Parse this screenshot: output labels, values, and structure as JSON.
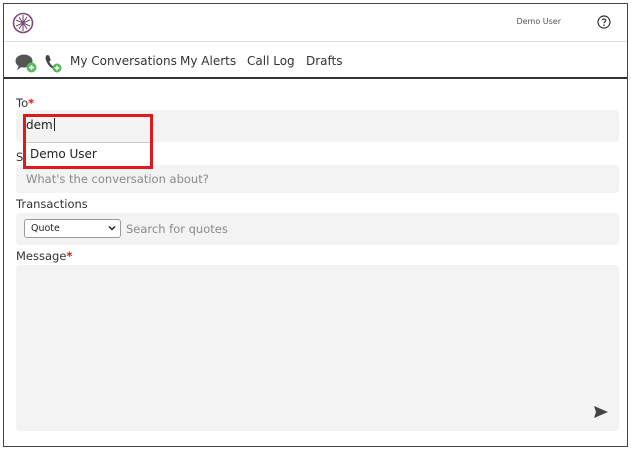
{
  "header": {
    "user_name": "Demo User"
  },
  "nav": {
    "links": [
      "My Conversations",
      "My Alerts",
      "Call Log",
      "Drafts"
    ]
  },
  "form": {
    "to_label": "To",
    "required_mark": "*",
    "to_value": "dem",
    "autocomplete_option": "Demo User",
    "subject_label_partial": "S",
    "subject_placeholder": "What's the conversation about?",
    "transactions_label": "Transactions",
    "transaction_type_selected": "Quote",
    "quote_search_placeholder": "Search for quotes",
    "message_label": "Message"
  },
  "colors": {
    "required": "#d61b1b",
    "highlight": "#e0191f",
    "field_bg": "#f3f3f3",
    "icon_green": "#5cb85c",
    "logo": "#7a4a72"
  },
  "icons": [
    "logo-icon",
    "help-icon",
    "chat-add-icon",
    "phone-add-icon",
    "chevron-down-icon",
    "send-icon"
  ]
}
